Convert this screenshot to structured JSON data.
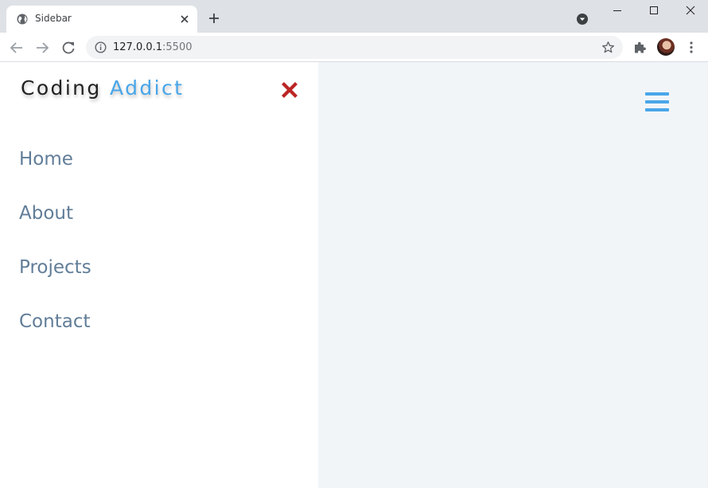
{
  "browser": {
    "tab_title": "Sidebar",
    "url_host": "127.0.0.1",
    "url_port": ":5500"
  },
  "sidebar": {
    "logo_part1": "Coding",
    "logo_part2": "Addict",
    "links": [
      {
        "label": "Home"
      },
      {
        "label": "About"
      },
      {
        "label": "Projects"
      },
      {
        "label": "Contact"
      }
    ]
  },
  "colors": {
    "accent": "#49a6e9",
    "close": "#bb2525",
    "link": "#617d98",
    "background": "#f1f5f8"
  },
  "icons": {
    "close": "close-x-icon",
    "toggle": "hamburger-menu-icon"
  }
}
